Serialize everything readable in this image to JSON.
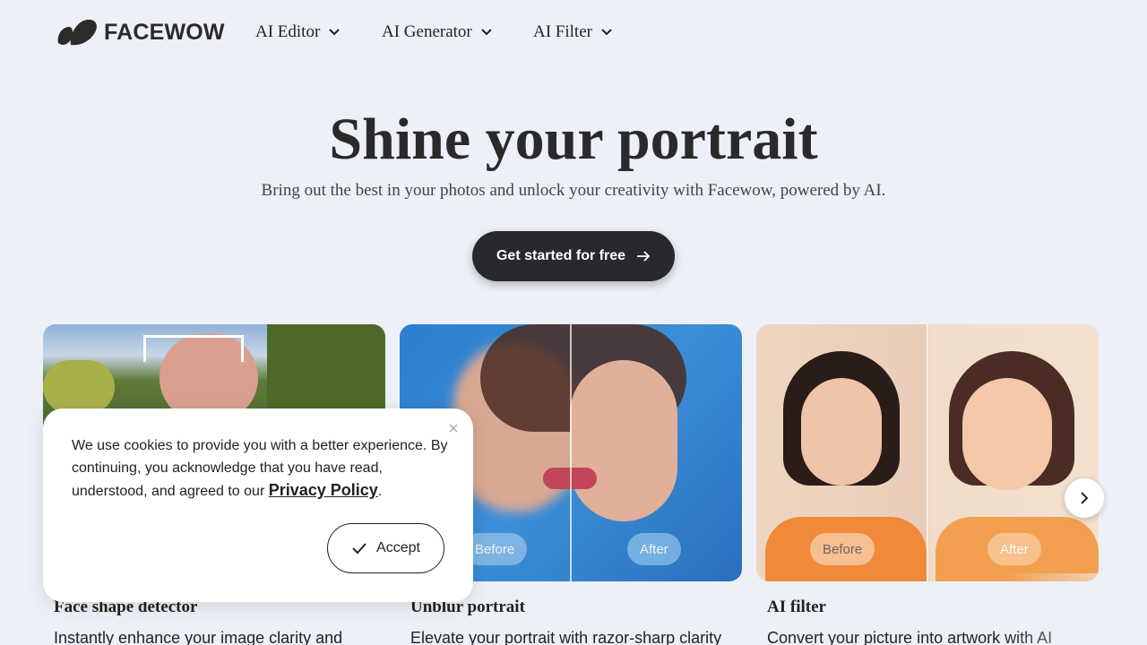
{
  "brand": {
    "name": "FACEWOW",
    "logo_icon": "facewow-logo-icon"
  },
  "nav": {
    "items": [
      {
        "label": "AI Editor",
        "icon": "chevron-down-icon"
      },
      {
        "label": "AI Generator",
        "icon": "chevron-down-icon"
      },
      {
        "label": "AI Filter",
        "icon": "chevron-down-icon"
      }
    ]
  },
  "hero": {
    "title": "Shine your portrait",
    "subtitle": "Bring out the best in your photos and unlock your creativity with Facewow, powered by AI.",
    "cta_label": "Get started for free",
    "cta_icon": "arrow-right-icon"
  },
  "cards": [
    {
      "title": "Face shape detector",
      "description": "Instantly enhance your image clarity and"
    },
    {
      "title": "Unblur portrait",
      "description": "Elevate your portrait with razor-sharp clarity",
      "before_label": "Before",
      "after_label": "After"
    },
    {
      "title": "AI filter",
      "description": "Convert your picture into artwork with AI",
      "before_label": "Before",
      "after_label": "After"
    }
  ],
  "carousel": {
    "next_icon": "chevron-right-icon"
  },
  "cookie": {
    "text": "We use cookies to provide you with a better experience. By continuing, you acknowledge that you have read, understood, and agreed to our ",
    "link_label": "Privacy Policy",
    "suffix": ".",
    "accept_label": "Accept",
    "accept_icon": "check-icon",
    "close_icon": "close-icon"
  },
  "colors": {
    "background": "#edf0f7",
    "cta": "#27292c",
    "text": "#222222"
  }
}
